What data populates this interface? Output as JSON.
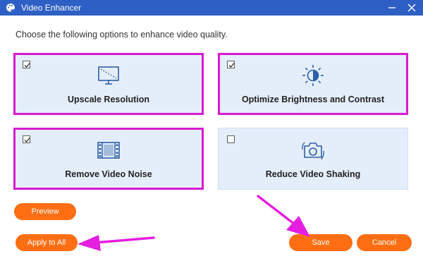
{
  "window": {
    "title": "Video Enhancer",
    "app_icon": "palette-icon",
    "controls": [
      "minimize-icon",
      "close-icon"
    ]
  },
  "instruction": "Choose the following options to enhance video quality.",
  "options": [
    {
      "label": "Upscale Resolution",
      "checked": true,
      "icon": "display-icon",
      "highlighted": true
    },
    {
      "label": "Optimize Brightness and Contrast",
      "checked": true,
      "icon": "brightness-icon",
      "highlighted": true
    },
    {
      "label": "Remove Video Noise",
      "checked": true,
      "icon": "film-strip-icon",
      "highlighted": true
    },
    {
      "label": "Reduce Video Shaking",
      "checked": false,
      "icon": "camera-icon",
      "highlighted": false
    }
  ],
  "buttons": {
    "preview": "Preview",
    "apply_to_all": "Apply to All",
    "save": "Save",
    "cancel": "Cancel"
  },
  "colors": {
    "titlebar": "#2e5fc4",
    "card_bg": "#e4eefb",
    "accent_button": "#ff6e12",
    "highlight": "#d91ad0",
    "icon": "#2d5ea8"
  }
}
